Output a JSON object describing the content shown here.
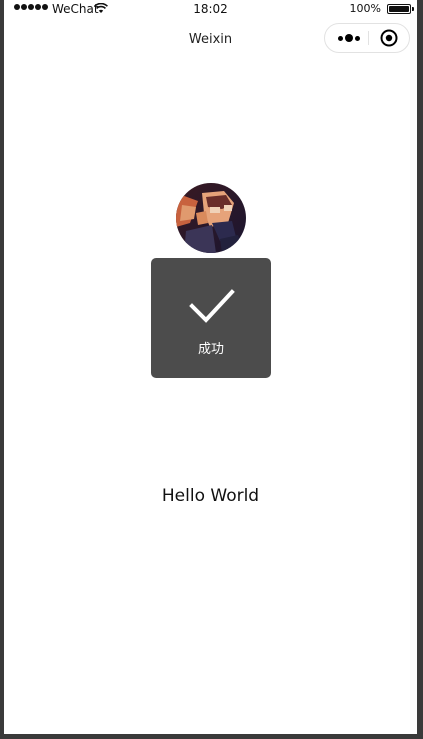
{
  "status_bar": {
    "carrier": "WeChat",
    "time": "18:02",
    "battery": "100%"
  },
  "nav": {
    "title": "Weixin"
  },
  "toast": {
    "text": "成功",
    "icon": "checkmark-icon"
  },
  "content": {
    "hello": "Hello World"
  },
  "colors": {
    "toast_bg": "#4c4c4c",
    "page_bg": "#ffffff",
    "frame_bg": "#3a3a3a"
  }
}
